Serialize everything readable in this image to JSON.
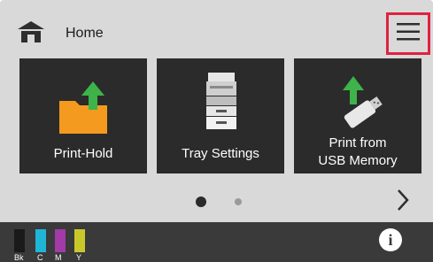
{
  "header": {
    "home_label": "Home"
  },
  "tiles": [
    {
      "label": "Print-Hold",
      "icon": "folder-upload-icon"
    },
    {
      "label": "Tray Settings",
      "icon": "printer-icon"
    },
    {
      "label_line1": "Print from",
      "label_line2": "USB Memory",
      "icon": "usb-upload-icon"
    }
  ],
  "pager": {
    "pages": 2,
    "current": 1
  },
  "toner": [
    {
      "label": "Bk",
      "color": "#1a1a1a"
    },
    {
      "label": "C",
      "color": "#1fb5d6"
    },
    {
      "label": "M",
      "color": "#a23aa8"
    },
    {
      "label": "Y",
      "color": "#c9c82a"
    }
  ],
  "colors": {
    "accent_highlight": "#e0223f",
    "tile_bg": "#2b2b2b",
    "folder_orange": "#f39a1f",
    "arrow_green": "#3db34a"
  }
}
